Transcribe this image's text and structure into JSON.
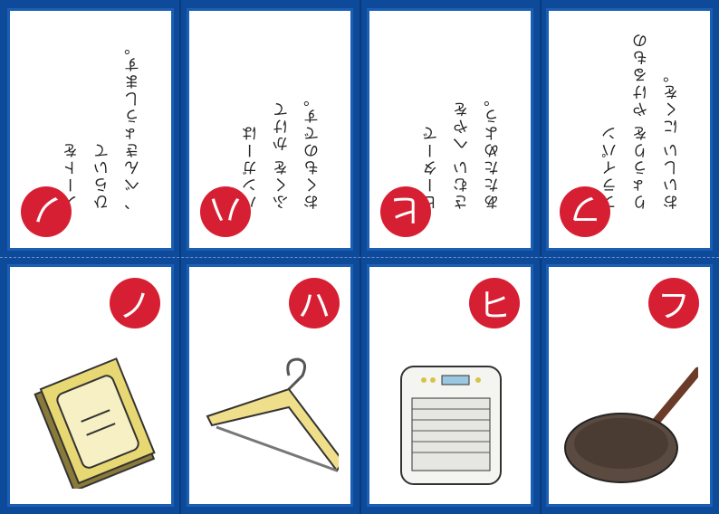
{
  "cards": [
    {
      "kana": "ノ",
      "verse": [
        "ノートを",
        "ひらいて",
        "、べんきょうします。"
      ],
      "picture": "notebook"
    },
    {
      "kana": "ハ",
      "verse": [
        "ハンガーは",
        "ふくを かけて",
        "おくものです。"
      ],
      "picture": "hanger"
    },
    {
      "kana": "ヒ",
      "verse": [
        "ヒーターで",
        "さむい へやを",
        "あたためよう。"
      ],
      "picture": "heater"
    },
    {
      "kana": "フ",
      "verse": [
        "フライパン",
        "りょうりを やけるもの",
        "おいしい にくを。"
      ],
      "picture": "frying-pan"
    }
  ],
  "colors": {
    "frame": "#0d4a9a",
    "circle": "#d71f33"
  }
}
